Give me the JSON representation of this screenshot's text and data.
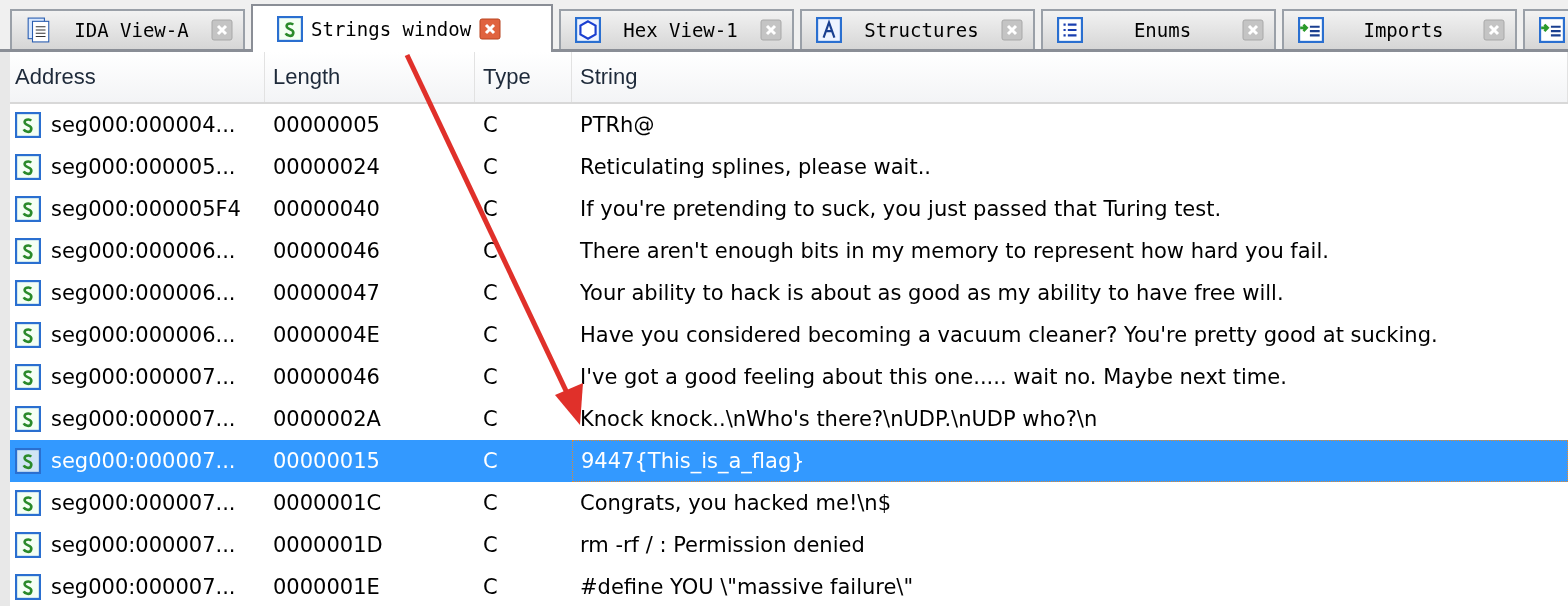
{
  "tabs": [
    {
      "kind": "disassembly",
      "label": "IDA View-A",
      "selected": false
    },
    {
      "kind": "strings",
      "label": "Strings window",
      "selected": true
    },
    {
      "kind": "hex",
      "label": "Hex View-1",
      "selected": false
    },
    {
      "kind": "structures",
      "label": "Structures",
      "selected": false
    },
    {
      "kind": "enums",
      "label": "Enums",
      "selected": false
    },
    {
      "kind": "imports",
      "label": "Imports",
      "selected": false
    },
    {
      "kind": "exports",
      "selected": false
    }
  ],
  "table": {
    "columns": [
      "Address",
      "Length",
      "Type",
      "String"
    ],
    "rows": [
      {
        "address": "seg000:000004...",
        "length": "00000005",
        "type": "C",
        "string": "PTRh@",
        "selected": false
      },
      {
        "address": "seg000:000005...",
        "length": "00000024",
        "type": "C",
        "string": "Reticulating splines, please wait..",
        "selected": false
      },
      {
        "address": "seg000:000005F4",
        "length": "00000040",
        "type": "C",
        "string": "If you're pretending to suck, you just passed that Turing test.",
        "selected": false
      },
      {
        "address": "seg000:000006...",
        "length": "00000046",
        "type": "C",
        "string": "There aren't enough bits in my memory to represent how hard you fail.",
        "selected": false
      },
      {
        "address": "seg000:000006...",
        "length": "00000047",
        "type": "C",
        "string": "Your ability to hack is about as good as my ability to have free will.",
        "selected": false
      },
      {
        "address": "seg000:000006...",
        "length": "0000004E",
        "type": "C",
        "string": "Have you considered becoming a vacuum cleaner? You're pretty good at sucking.",
        "selected": false
      },
      {
        "address": "seg000:000007...",
        "length": "00000046",
        "type": "C",
        "string": "I've got a good feeling about this one..... wait no. Maybe next time.",
        "selected": false
      },
      {
        "address": "seg000:000007...",
        "length": "0000002A",
        "type": "C",
        "string": "Knock knock..\\nWho's there?\\nUDP.\\nUDP who?\\n",
        "selected": false
      },
      {
        "address": "seg000:000007...",
        "length": "00000015",
        "type": "C",
        "string": "9447{This_is_a_flag}",
        "selected": true
      },
      {
        "address": "seg000:000007...",
        "length": "0000001C",
        "type": "C",
        "string": "Congrats, you hacked me!\\n$",
        "selected": false
      },
      {
        "address": "seg000:000007...",
        "length": "0000001D",
        "type": "C",
        "string": "rm -rf / : Permission denied",
        "selected": false
      },
      {
        "address": "seg000:000007...",
        "length": "0000001E",
        "type": "C",
        "string": "#define YOU \\\"massive failure\\\"",
        "selected": false
      }
    ]
  }
}
